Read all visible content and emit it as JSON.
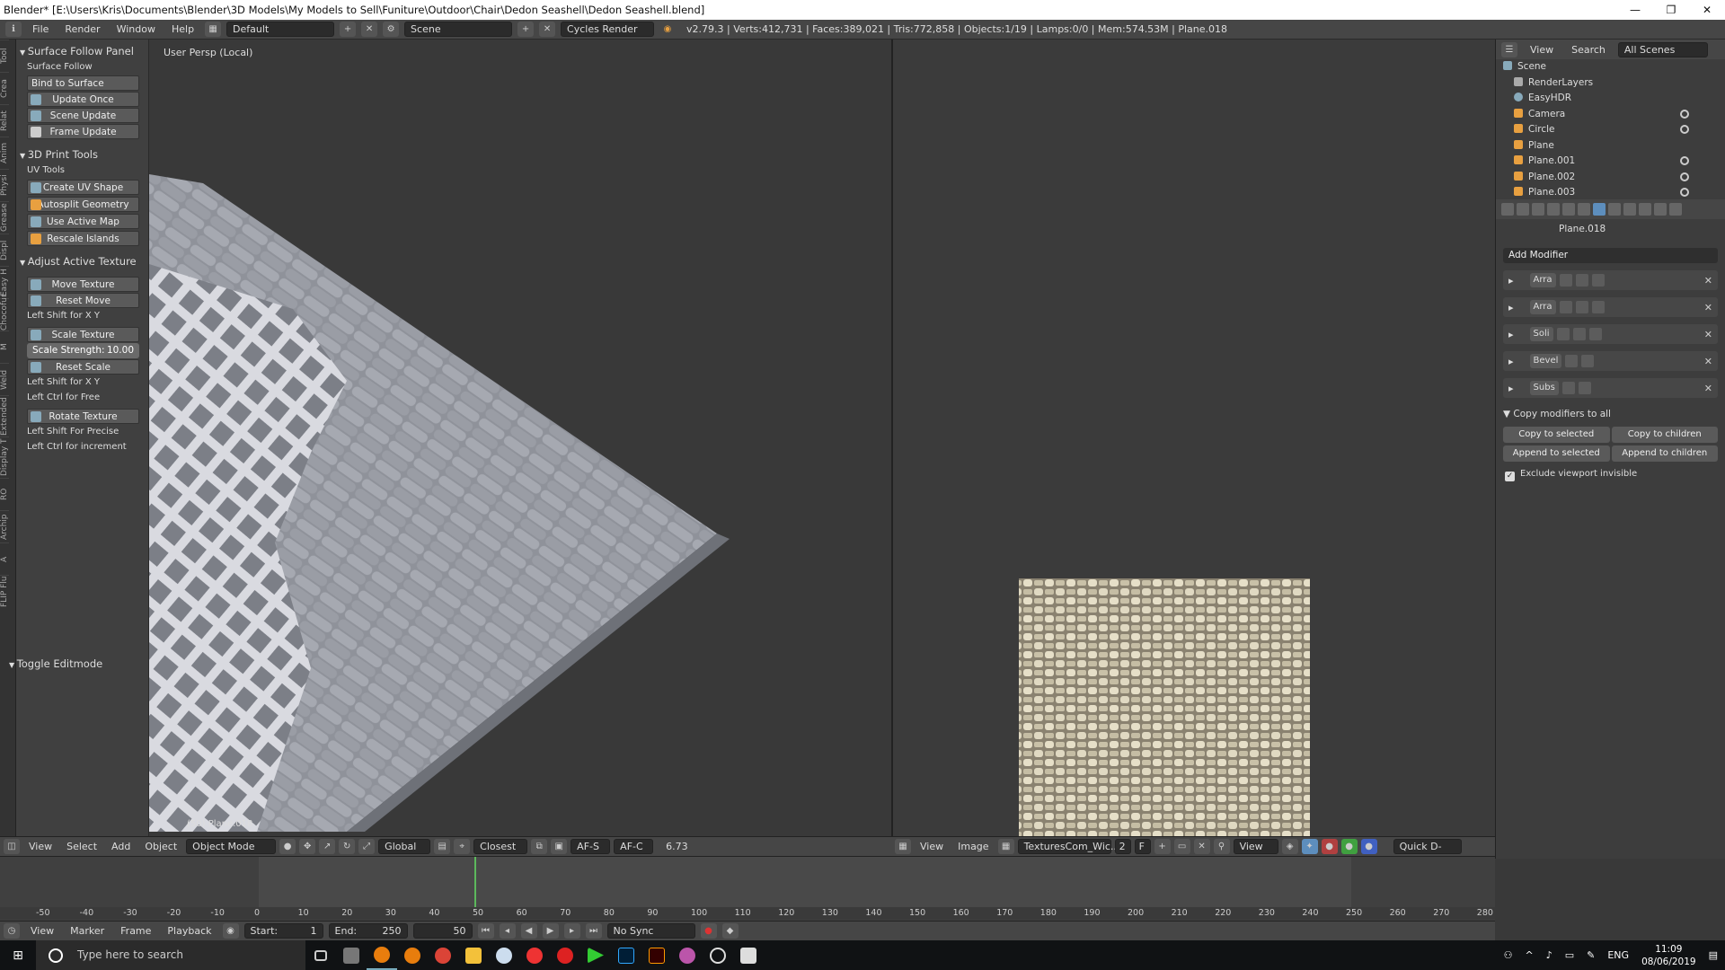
{
  "titlebar": {
    "title": "Blender* [E:\\Users\\Kris\\Documents\\Blender\\3D Models\\My Models to Sell\\Funiture\\Outdoor\\Chair\\Dedon Seashell\\Dedon Seashell.blend]",
    "min": "—",
    "max": "❐",
    "close": "✕"
  },
  "infobar": {
    "menus": [
      "File",
      "Render",
      "Window",
      "Help"
    ],
    "layout": "Default",
    "scene": "Scene",
    "engine": "Cycles Render",
    "stats": "v2.79.3 | Verts:412,731 | Faces:389,021 | Tris:772,858 | Objects:1/19 | Lamps:0/0 | Mem:574.53M | Plane.018"
  },
  "tabs": [
    "Tool",
    "Crea",
    "Relat",
    "Anim",
    "Physi",
    "Grease",
    "Displ",
    "Easy H",
    "Chocofur",
    "M",
    "Weld",
    "Extended",
    "Display T",
    "RO",
    "Archip",
    "A",
    "FLIP Flu"
  ],
  "toolshelf": {
    "surface_panel": "Surface Follow Panel",
    "surface_follow": "Surface Follow",
    "bind_to_surface": "Bind to Surface",
    "update_once": "Update Once",
    "scene_update": "Scene Update",
    "frame_update": "Frame Update",
    "print_panel": "3D Print Tools",
    "uv_tools": "UV Tools",
    "create_uv_shape": "Create UV Shape",
    "autosplit": "Autosplit Geometry",
    "use_active_map": "Use Active Map",
    "rescale_islands": "Rescale Islands",
    "adjust_panel": "Adjust Active Texture",
    "move_texture": "Move Texture",
    "reset_move": "Reset Move",
    "hint_shift_xy": "Left Shift for X Y",
    "scale_texture": "Scale Texture",
    "scale_strength_label": "Scale Strength:",
    "scale_strength_value": "10.00",
    "reset_scale": "Reset Scale",
    "hint_shift_xy2": "Left Shift for X Y",
    "hint_ctrl_free": "Left Ctrl for Free",
    "rotate_texture": "Rotate Texture",
    "hint_shift_precise": "Left Shift For Precise",
    "hint_ctrl_increment": "Left Ctrl for increment",
    "toggle_editmode": "Toggle Editmode"
  },
  "viewport3d": {
    "persp": "User Persp (Local)",
    "object": "(50) Plane.018"
  },
  "header3d": {
    "menus": [
      "View",
      "Select",
      "Add",
      "Object"
    ],
    "mode": "Object Mode",
    "orientation": "Global",
    "snap": "Closest",
    "afs": "AF-S",
    "afc": "AF-C",
    "value": "6.73"
  },
  "headerimg": {
    "menus": [
      "View",
      "Image"
    ],
    "image": "TexturesCom_Wic...",
    "users": "2",
    "fake": "F",
    "view": "View",
    "quick": "Quick D-NOI"
  },
  "outliner": {
    "menus": [
      "View",
      "Search"
    ],
    "scenes": "All Scenes",
    "items": [
      "Scene",
      "RenderLayers",
      "EasyHDR",
      "Camera",
      "Circle",
      "Plane",
      "Plane.001",
      "Plane.002",
      "Plane.003"
    ]
  },
  "properties": {
    "object": "Plane.018",
    "add_modifier": "Add Modifier",
    "modifiers": [
      "Arra",
      "Arra",
      "Soli",
      "Bevel",
      "Subs"
    ],
    "copy_header": "Copy modifiers to all",
    "copy_selected": "Copy to selected",
    "copy_children": "Copy to children",
    "append_selected": "Append to selected",
    "append_children": "Append to children",
    "exclude": "Exclude viewport invisible"
  },
  "timeline": {
    "ticks": [
      "-50",
      "-40",
      "-30",
      "-20",
      "-10",
      "0",
      "10",
      "20",
      "30",
      "40",
      "50",
      "60",
      "70",
      "80",
      "90",
      "100",
      "110",
      "120",
      "130",
      "140",
      "150",
      "160",
      "170",
      "180",
      "190",
      "200",
      "210",
      "220",
      "230",
      "240",
      "250",
      "260",
      "270",
      "280"
    ],
    "menus": [
      "View",
      "Marker",
      "Frame",
      "Playback"
    ],
    "start_label": "Start:",
    "start": "1",
    "end_label": "End:",
    "end": "250",
    "current": "50",
    "sync": "No Sync"
  },
  "taskbar": {
    "search": "Type here to search",
    "lang": "ENG",
    "time": "11:09",
    "date": "08/06/2019"
  },
  "colors": {
    "accent": "#5d8ebd",
    "playhead": "#5cb85c"
  }
}
